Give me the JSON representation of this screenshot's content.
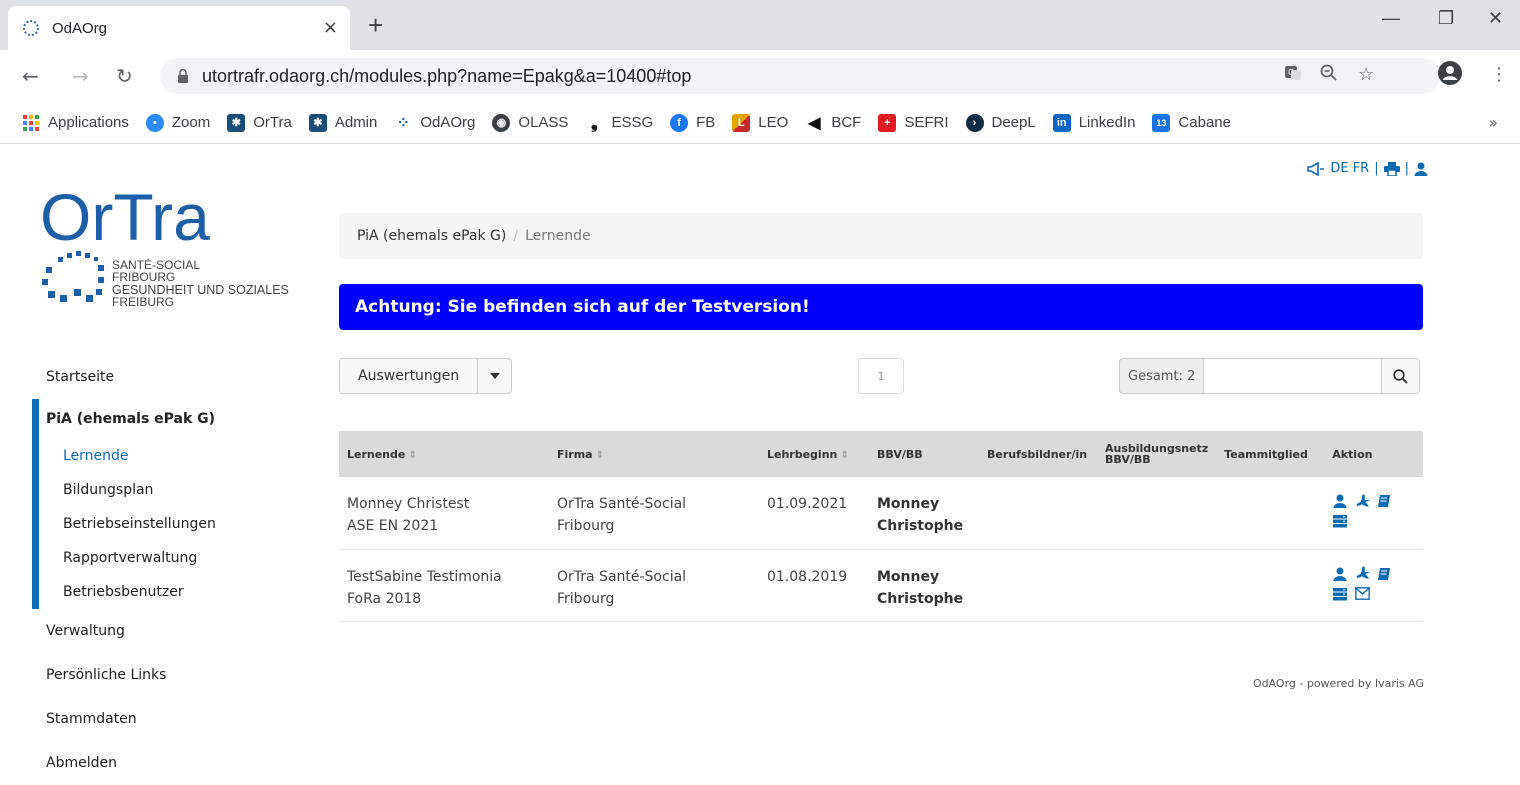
{
  "browser": {
    "tab_title": "OdAOrg",
    "tab_close": "×",
    "new_tab": "+",
    "win_minimize": "—",
    "win_restore": "❐",
    "win_close": "✕",
    "url": "utortrafr.odaorg.ch/modules.php?name=Epakg&a=10400#top",
    "bookmarks": [
      {
        "label": "Applications",
        "icon": "apps-grid-icon",
        "color": "#e8710a"
      },
      {
        "label": "Zoom",
        "icon": "zoom-icon",
        "color": "#2d8cff"
      },
      {
        "label": "OrTra",
        "icon": "ortra-icon",
        "color": "#1a4e7a"
      },
      {
        "label": "Admin",
        "icon": "admin-icon",
        "color": "#1a4e7a"
      },
      {
        "label": "OdAOrg",
        "icon": "odaorg-icon",
        "color": "#2a6ab0"
      },
      {
        "label": "OLASS",
        "icon": "globe-icon",
        "color": "#3c4043"
      },
      {
        "label": "ESSG",
        "icon": "essg-icon",
        "color": "#111111"
      },
      {
        "label": "FB",
        "icon": "facebook-icon",
        "color": "#1877f2"
      },
      {
        "label": "LEO",
        "icon": "leo-icon",
        "color": "#e8a200"
      },
      {
        "label": "BCF",
        "icon": "bcf-icon",
        "color": "#111111"
      },
      {
        "label": "SEFRI",
        "icon": "swiss-cross-icon",
        "color": "#e21b23"
      },
      {
        "label": "DeepL",
        "icon": "deepl-icon",
        "color": "#0f2b46"
      },
      {
        "label": "LinkedIn",
        "icon": "linkedin-icon",
        "color": "#0a66c2"
      },
      {
        "label": "Cabane",
        "icon": "calendar-icon",
        "color": "#1a73e8",
        "badge": "13"
      }
    ],
    "more": "»"
  },
  "toplinks": {
    "lang": "DE FR",
    "sep": "|"
  },
  "logo": {
    "name": "OrTra",
    "line1": "SANTÉ-SOCIAL",
    "line2": "FRIBOURG",
    "line3": "GESUNDHEIT UND SOZIALES",
    "line4": "FREIBURG",
    "accent": "#1a5fa8"
  },
  "sidebar": {
    "items_top": [
      "Startseite"
    ],
    "active_group": {
      "label": "PiA (ehemals ePak G)",
      "subitems": [
        "Lernende",
        "Bildungsplan",
        "Betriebseinstellungen",
        "Rapportverwaltung",
        "Betriebsbenutzer"
      ],
      "active_index": 0
    },
    "items_bottom": [
      "Verwaltung",
      "Persönliche Links",
      "Stammdaten",
      "Abmelden"
    ]
  },
  "breadcrumb": {
    "parent": "PiA (ehemals ePak G)",
    "separator": "/",
    "current": "Lernende"
  },
  "alert": {
    "text": "Achtung: Sie befinden sich auf der Testversion!",
    "color": "#0000ff"
  },
  "toolbar": {
    "auswertungen_label": "Auswertungen",
    "page": "1",
    "total_label": "Gesamt: 2",
    "search_placeholder": ""
  },
  "table": {
    "columns": [
      "Lernende",
      "Firma",
      "Lehrbeginn",
      "BBV/BB",
      "Berufsbildner/in",
      "Ausbildungsnetz BBV/BB",
      "Teammitglied",
      "Aktion"
    ],
    "rows": [
      {
        "name": "Monney Christest",
        "class": "ASE EN 2021",
        "firma1": "OrTra Santé-Social",
        "firma2": "Fribourg",
        "start": "01.09.2021",
        "bbv1": "Monney",
        "bbv2": "Christophe",
        "mail": false
      },
      {
        "name": "TestSabine Testimonia",
        "class": "FoRa 2018",
        "firma1": "OrTra Santé-Social",
        "firma2": "Fribourg",
        "start": "01.08.2019",
        "bbv1": "Monney",
        "bbv2": "Christophe",
        "mail": true
      }
    ]
  },
  "footer": {
    "text": "OdAOrg - powered by Ivaris AG"
  },
  "colors": {
    "accent": "#0a6bb5",
    "header_bg": "#dadada"
  }
}
